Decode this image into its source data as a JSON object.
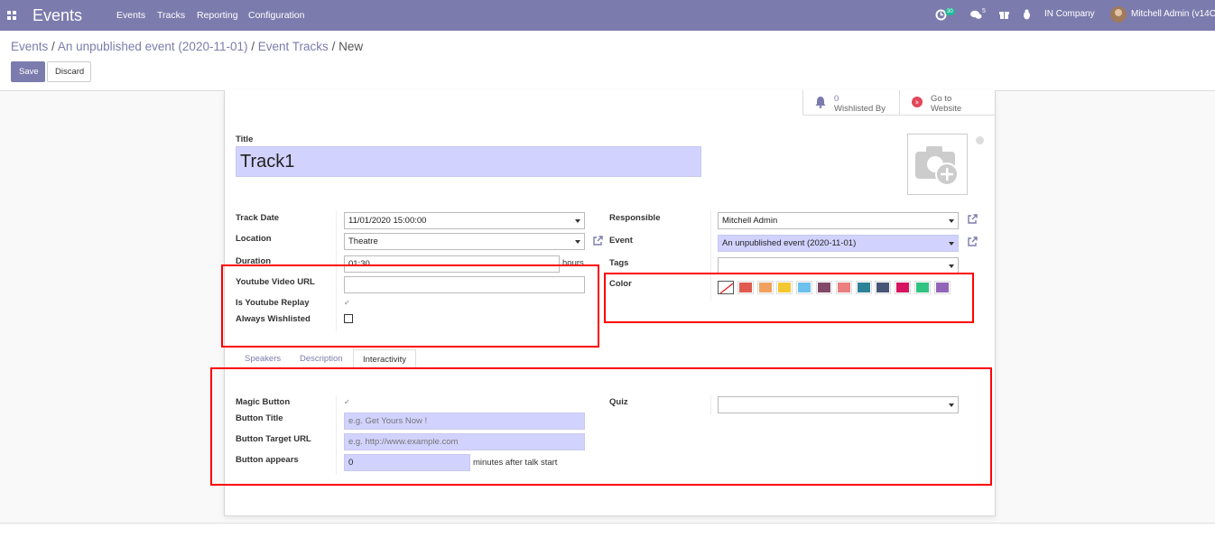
{
  "navbar": {
    "brand": "Events",
    "menu": [
      "Events",
      "Tracks",
      "Reporting",
      "Configuration"
    ],
    "activity_count": "30",
    "messages_count": "5",
    "company": "IN Company",
    "user": "Mitchell Admin (v14C"
  },
  "breadcrumb": {
    "items": [
      "Events",
      "An unpublished event (2020-11-01)",
      "Event Tracks"
    ],
    "current": "New",
    "separator": "/"
  },
  "buttons": {
    "save": "Save",
    "discard": "Discard"
  },
  "smart_buttons": {
    "wishlisted_count": "0",
    "wishlisted_label": "Wishlisted By",
    "website_line1": "Go to",
    "website_line2": "Website"
  },
  "form": {
    "title_label": "Title",
    "title_value": "Track1",
    "track_date_label": "Track Date",
    "track_date_value": "11/01/2020 15:00:00",
    "location_label": "Location",
    "location_value": "Theatre",
    "duration_label": "Duration",
    "duration_value": "01:30",
    "duration_unit": "hours",
    "youtube_url_label": "Youtube Video URL",
    "youtube_url_value": "",
    "youtube_replay_label": "Is Youtube Replay",
    "always_wishlisted_label": "Always Wishlisted",
    "responsible_label": "Responsible",
    "responsible_value": "Mitchell Admin",
    "event_label": "Event",
    "event_value": "An unpublished event (2020-11-01)",
    "tags_label": "Tags",
    "tags_value": "",
    "color_label": "Color",
    "colors": [
      "#ffffff",
      "#e05a4f",
      "#f0a15f",
      "#f3c830",
      "#6cc1ed",
      "#814968",
      "#eb7e7f",
      "#2c8397",
      "#475577",
      "#d6145f",
      "#30c381",
      "#9365b8"
    ]
  },
  "tabs": [
    "Speakers",
    "Description",
    "Interactivity"
  ],
  "interactivity": {
    "magic_button_label": "Magic Button",
    "button_title_label": "Button Title",
    "button_title_placeholder": "e.g. Get Yours Now !",
    "button_url_label": "Button Target URL",
    "button_url_placeholder": "e.g. http://www.example.com",
    "button_appears_label": "Button appears",
    "button_appears_value": "0",
    "button_appears_unit": "minutes after talk start",
    "quiz_label": "Quiz",
    "quiz_value": ""
  },
  "colors": {
    "brand": "#7c7bad",
    "highlight": "#ff0000",
    "required": "#d2d2ff"
  }
}
